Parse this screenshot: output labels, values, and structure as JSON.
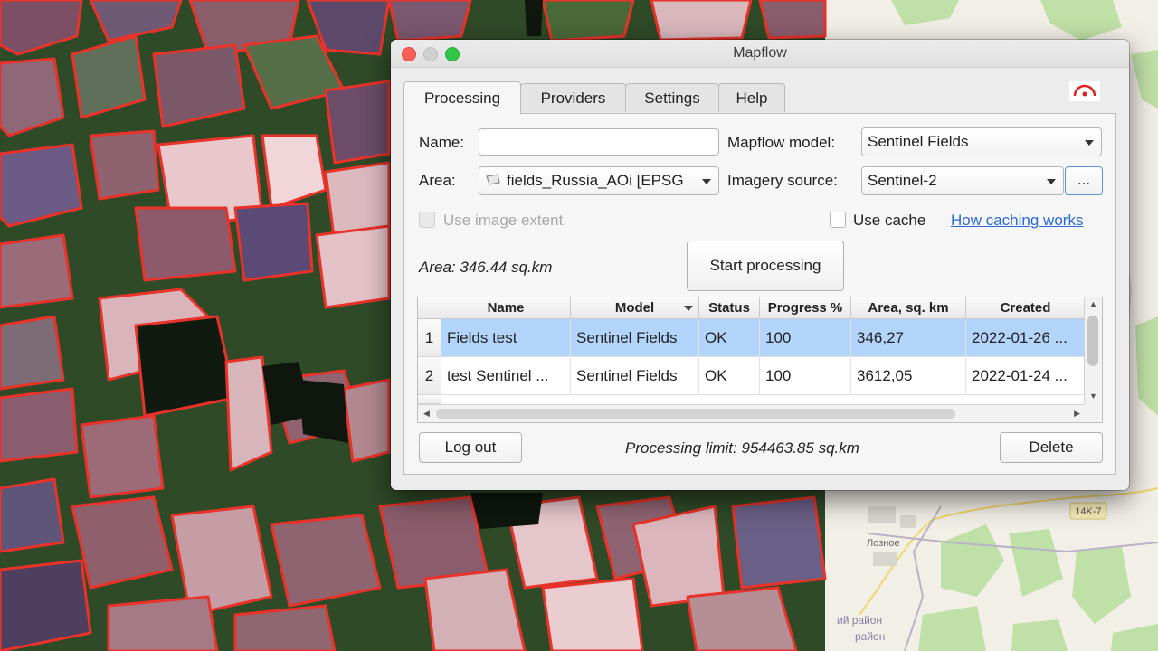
{
  "window": {
    "title": "Mapflow"
  },
  "tabs": [
    {
      "label": "Processing",
      "active": true
    },
    {
      "label": "Providers",
      "active": false
    },
    {
      "label": "Settings",
      "active": false
    },
    {
      "label": "Help",
      "active": false
    }
  ],
  "form": {
    "name_label": "Name:",
    "name_value": "",
    "model_label": "Mapflow model:",
    "model_value": "Sentinel Fields",
    "area_label": "Area:",
    "area_value": "fields_Russia_AOi [EPSG",
    "imagery_label": "Imagery source:",
    "imagery_value": "Sentinel-2",
    "more_button": "...",
    "use_extent_label": "Use image extent",
    "use_cache_label": "Use cache",
    "cache_link": "How caching works",
    "area_info": "Area: 346.44 sq.km",
    "start_button": "Start processing"
  },
  "table": {
    "columns": [
      "Name",
      "Model",
      "Status",
      "Progress %",
      "Area, sq. km",
      "Created"
    ],
    "rows": [
      {
        "index": "1",
        "name": "Fields test",
        "model": "Sentinel Fields",
        "status": "OK",
        "progress": "100",
        "area": "346,27",
        "created": "2022-01-26 ...",
        "selected": true
      },
      {
        "index": "2",
        "name": "test Sentinel ...",
        "model": "Sentinel Fields",
        "status": "OK",
        "progress": "100",
        "area": "3612,05",
        "created": "2022-01-24 ...",
        "selected": false
      }
    ]
  },
  "footer": {
    "logout_button": "Log out",
    "limit_text": "Processing limit: 954463.85 sq.km",
    "delete_button": "Delete"
  },
  "map_labels": {
    "road_tag": "14K-7",
    "village": "Лозное",
    "district_1": "ий район",
    "district_2": "район"
  },
  "colors": {
    "field_outline": "#e8322a",
    "selection": "#b3d4fb",
    "link": "#2a6ad6"
  }
}
